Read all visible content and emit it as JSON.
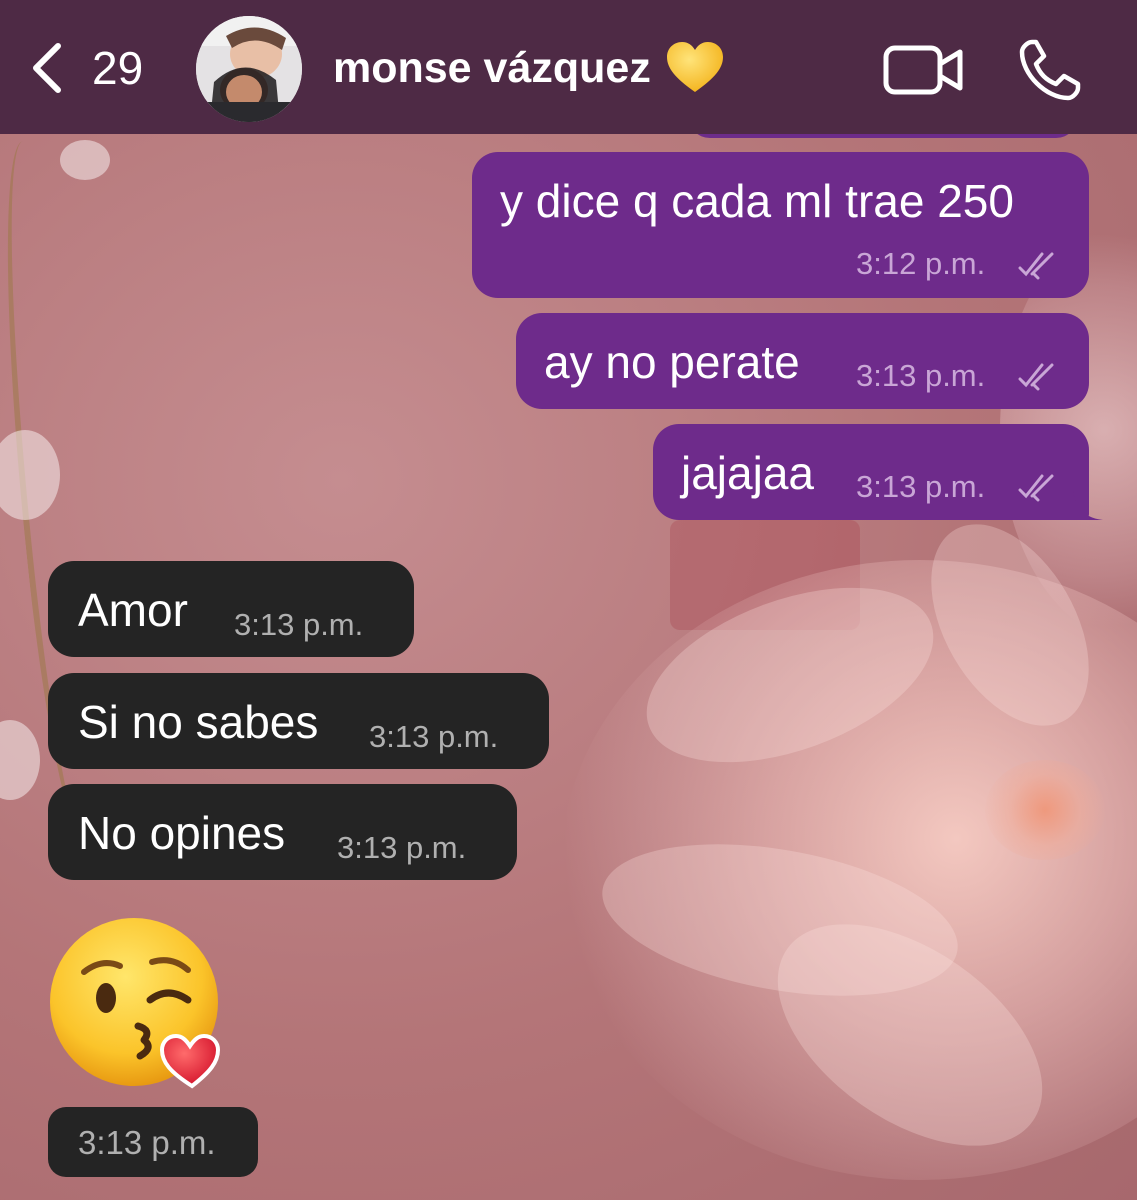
{
  "header": {
    "back_count": "29",
    "contact_name": "monse vázquez",
    "icons": [
      "chevron-left-icon",
      "yellow-heart-icon",
      "video-camera-icon",
      "phone-icon"
    ]
  },
  "messages": [
    {
      "direction": "outgoing",
      "text": "y dice q cada ml trae 250",
      "time": "3:12 p.m.",
      "status": "read"
    },
    {
      "direction": "outgoing",
      "text": "ay no perate",
      "time": "3:13 p.m.",
      "status": "read"
    },
    {
      "direction": "outgoing",
      "text": "jajajaa",
      "time": "3:13 p.m.",
      "status": "read"
    },
    {
      "direction": "incoming",
      "text": "Amor",
      "time": "3:13 p.m."
    },
    {
      "direction": "incoming",
      "text": "Si no sabes",
      "time": "3:13 p.m."
    },
    {
      "direction": "incoming",
      "text": "No opines",
      "time": "3:13 p.m."
    },
    {
      "direction": "incoming",
      "emoji": "face-blowing-a-kiss",
      "time": "3:13 p.m."
    }
  ],
  "colors": {
    "header": "#4e2a45",
    "outgoing_bubble": "#6e2b8b",
    "incoming_bubble": "#242424",
    "background": "#b97b80"
  }
}
